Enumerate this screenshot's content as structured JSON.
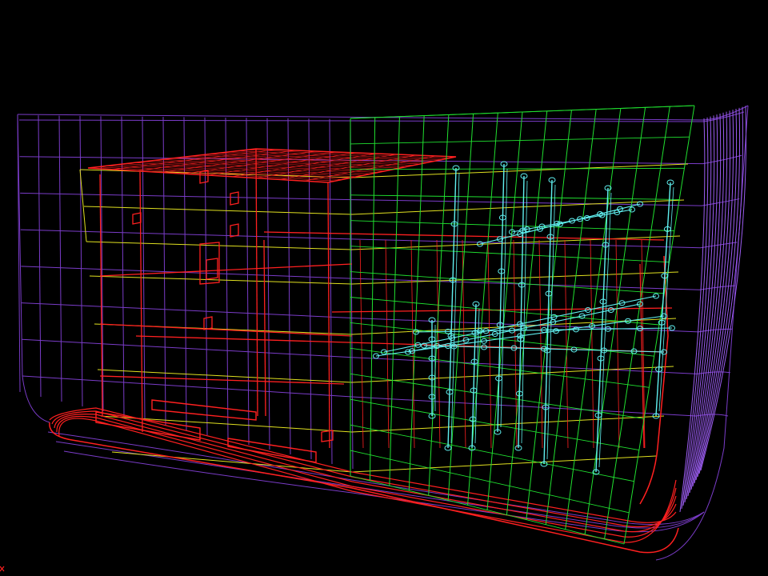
{
  "scene": {
    "type": "3d-wireframe-structural-model",
    "background": "#000000",
    "colors": {
      "hull": "#7a3cc8",
      "hull_light": "#9b5cf0",
      "deck": "#e0e020",
      "bulkhead": "#ff2020",
      "frames": "#20e030",
      "pipes": "#60f0f0",
      "corner_mark": "#ff2020"
    },
    "layers": [
      "hull-grid",
      "deck-planes",
      "red-structure",
      "green-frames",
      "cyan-piping"
    ]
  }
}
